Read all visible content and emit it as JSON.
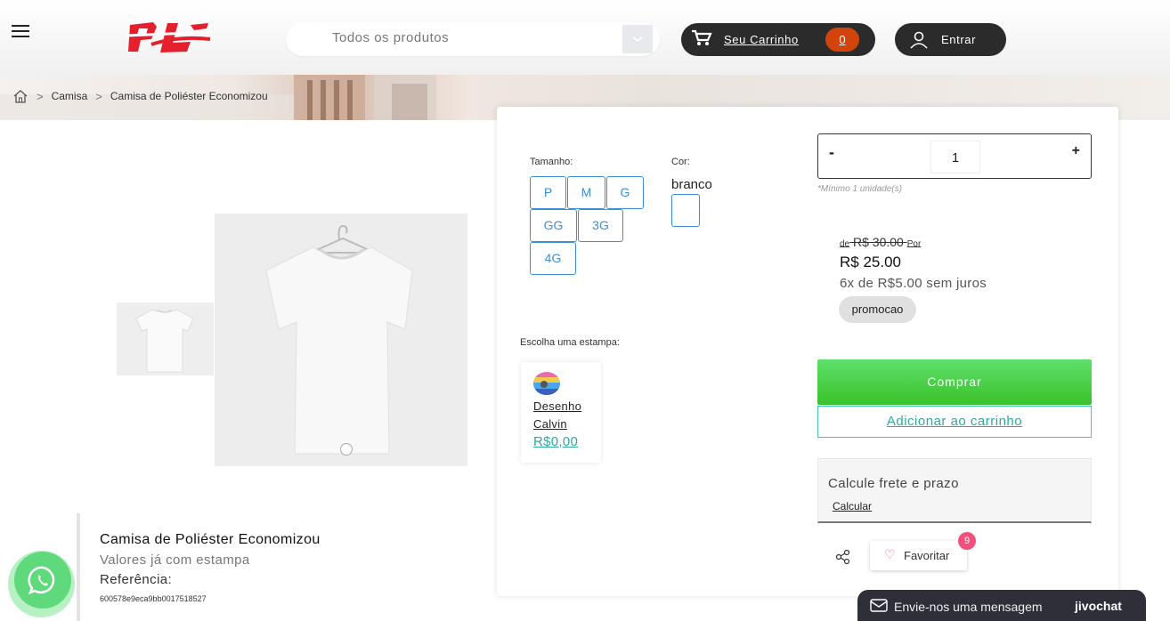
{
  "header": {
    "search_placeholder": "Todos os produtos",
    "cart_label": "Seu Carrinho",
    "cart_count": "0",
    "login_label": "Entrar"
  },
  "breadcrumb": {
    "items": [
      "Camisa",
      "Camisa de Poliéster Economizou"
    ]
  },
  "options": {
    "size_label": "Tamanho:",
    "sizes": [
      "P",
      "M",
      "G",
      "GG",
      "3G",
      "4G"
    ],
    "color_label": "Cor:",
    "color_value": "branco",
    "stamp_label": "Escolha uma estampa:",
    "stamp_name": "Desenho Calvin",
    "stamp_price": "R$0,00"
  },
  "quantity": {
    "minus": "-",
    "plus": "+",
    "value": "1",
    "min_note": "*Mínimo 1 unidade(s)"
  },
  "price": {
    "old_prefix": "de",
    "old": "R$ 30.00",
    "old_suffix": "Por",
    "current": "R$ 25.00",
    "installments": "6x de R$5.00 sem juros",
    "tag": "promocao"
  },
  "actions": {
    "buy": "Comprar",
    "add_to_cart": "Adicionar ao carrinho",
    "favorite": "Favoritar",
    "favorite_count": "9"
  },
  "shipping": {
    "title": "Calcule frete e prazo",
    "link": "Calcular"
  },
  "product": {
    "title": "Camisa de Poliéster Economizou",
    "subtitle": "Valores já com estampa",
    "reference_label": "Referência:",
    "reference": "600578e9eca9bb0017518527"
  },
  "chat": {
    "message": "Envie-nos uma mensagem",
    "brand": "jivochat"
  },
  "colors": {
    "dark_pill": "#2b2b2b",
    "cart_badge": "#d3430c",
    "accent_blue": "#3b8fd4",
    "teal": "#2fa9a0",
    "buy_green": "#3bc12a",
    "logo_red": "#e3202b"
  }
}
